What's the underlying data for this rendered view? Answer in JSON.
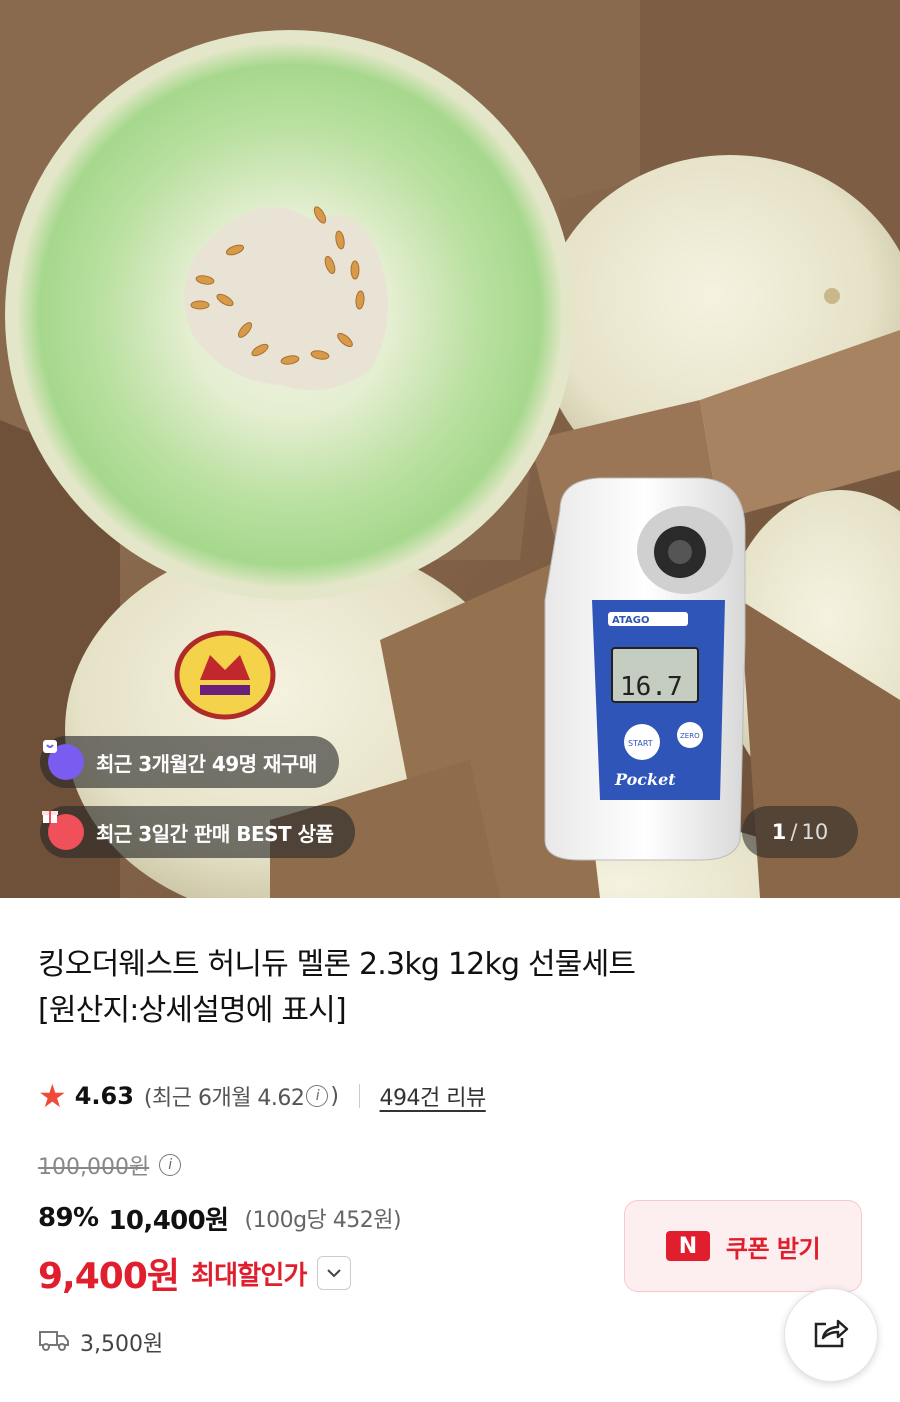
{
  "gallery": {
    "image_alt": "honeydew melon in box with refractometer",
    "counter_current": "1",
    "counter_separator": "/",
    "counter_total": "10",
    "refractometer": {
      "brand": "ATAGO",
      "reading": "16.7",
      "model": "Pocket",
      "start_label": "START",
      "zero_label": "ZERO"
    }
  },
  "badges": [
    {
      "text": "최근 3개월간 49명 재구매",
      "icon": "repurchase-bag-icon",
      "color": "#7b5cf0"
    },
    {
      "text": "최근 3일간 판매 BEST 상품",
      "icon": "gift-box-icon",
      "color": "#f0505a"
    }
  ],
  "product": {
    "title_line1": "킹오더웨스트 허니듀 멜론 2.3kg 12kg 선물세트",
    "title_line2": "[원산지:상세설명에 표시]"
  },
  "rating": {
    "score": "4.63",
    "recent_prefix": "(최근 6개월 4.62",
    "recent_suffix": ")",
    "info_icon": "ⓘ",
    "review_link": "494건 리뷰"
  },
  "price": {
    "original": "100,000원",
    "discount_rate": "89%",
    "sale": "10,400원",
    "unit_price": "(100g당 452원)",
    "max_discount_price": "9,400원",
    "max_discount_label": "최대할인가"
  },
  "coupon": {
    "badge": "N",
    "label": "쿠폰 받기"
  },
  "shipping": {
    "fee": "3,500원"
  },
  "colors": {
    "accent_red": "#e01e2d",
    "star": "#f04a3a"
  }
}
